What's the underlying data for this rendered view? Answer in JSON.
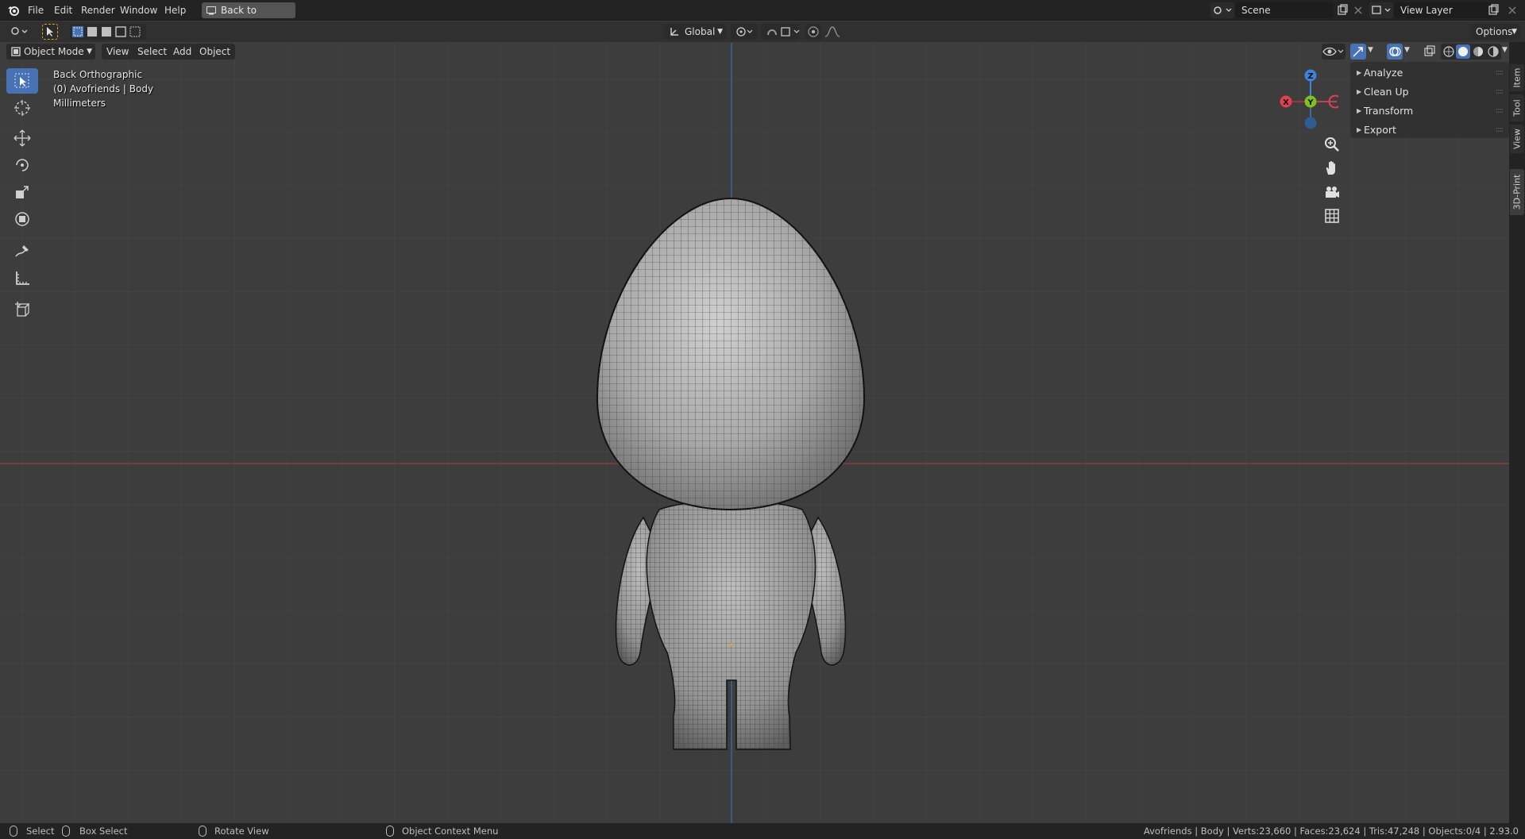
{
  "topbar": {
    "menus": [
      "File",
      "Edit",
      "Render",
      "Window",
      "Help"
    ],
    "back_button": "Back to Previous",
    "scene_field": "Scene",
    "view_layer_field": "View Layer"
  },
  "toolheader": {
    "orientation": "Global",
    "options": "Options"
  },
  "viewheader": {
    "mode": "Object Mode",
    "menus": [
      "View",
      "Select",
      "Add",
      "Object"
    ]
  },
  "viewport_info": {
    "view_name": "Back Orthographic",
    "object_info": "(0) Avofriends | Body",
    "units": "Millimeters"
  },
  "gizmo": {
    "x": "X",
    "y": "Y",
    "z": "Z"
  },
  "npanel": {
    "items": [
      "Analyze",
      "Clean Up",
      "Transform",
      "Export"
    ]
  },
  "sidetabs": [
    "Item",
    "Tool",
    "View",
    "3D-Print"
  ],
  "statusbar": {
    "select": "Select",
    "box_select": "Box Select",
    "rotate_view": "Rotate View",
    "context_menu": "Object Context Menu",
    "stats": "Avofriends | Body | Verts:23,660 | Faces:23,624 | Tris:47,248 | Objects:0/4 | 2.93.0"
  },
  "colors": {
    "accent": "#4772b3",
    "axis_x": "#e0404f",
    "axis_y": "#7fc11d",
    "axis_z": "#3f82d8",
    "viewport_bg": "#3d3d3d"
  }
}
